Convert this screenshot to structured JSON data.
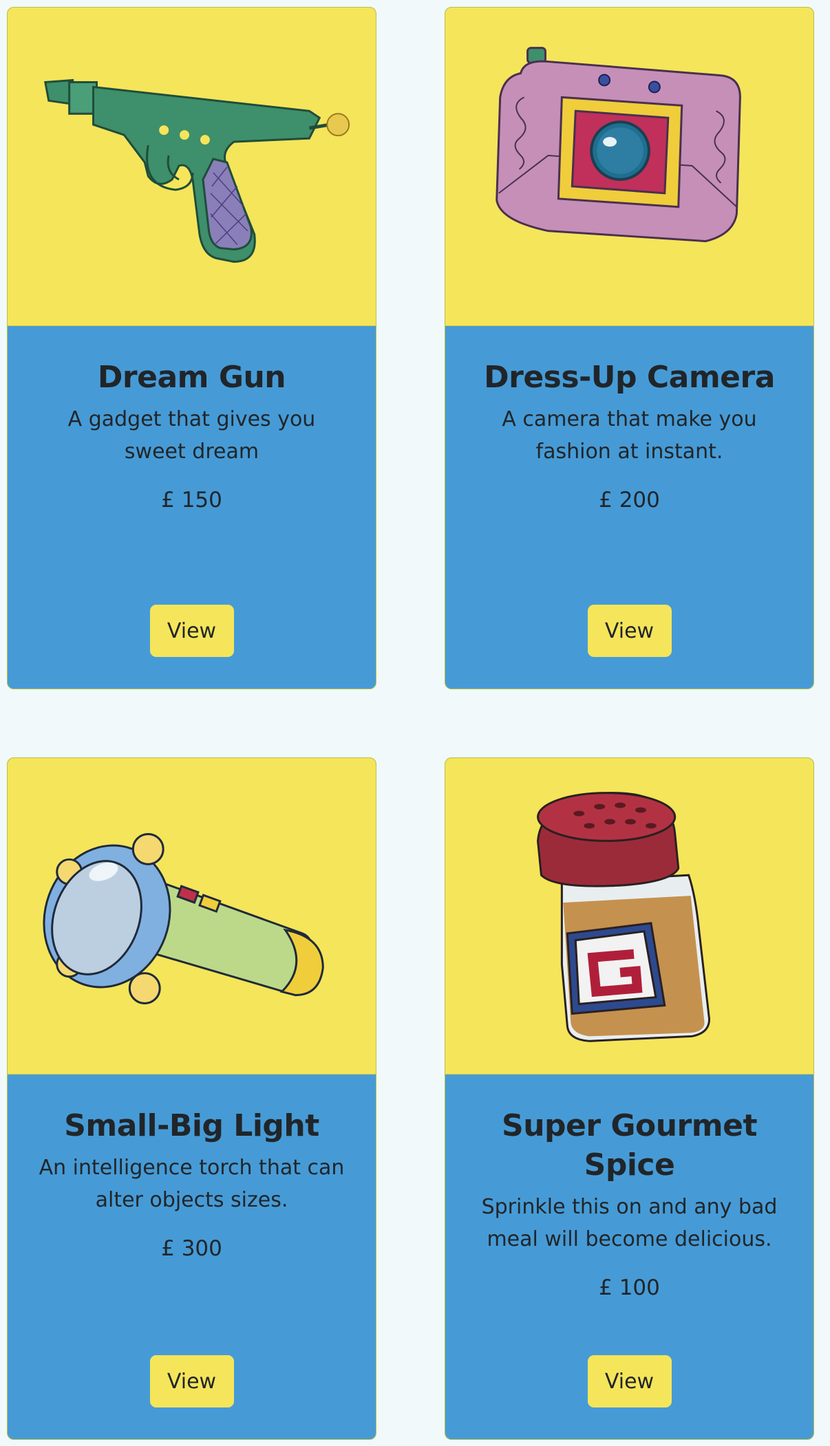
{
  "cards": [
    {
      "image_icon": "dream-gun-illustration",
      "title": "Dream Gun",
      "description": "A gadget that gives you sweet dream",
      "price": "£ 150",
      "button_label": "View"
    },
    {
      "image_icon": "dress-up-camera-illustration",
      "title": "Dress-Up Camera",
      "description": "A camera that make you fashion at instant.",
      "price": "£ 200",
      "button_label": "View"
    },
    {
      "image_icon": "small-big-light-illustration",
      "title": "Small-Big Light",
      "description": "An intelligence torch that can alter objects sizes.",
      "price": "£ 300",
      "button_label": "View"
    },
    {
      "image_icon": "super-gourmet-spice-illustration",
      "title": "Super Gourmet Spice",
      "description": "Sprinkle this on and any bad meal will become delicious.",
      "price": "£ 100",
      "button_label": "View"
    }
  ],
  "colors": {
    "page_background": "#f1f9fb",
    "card_image_background": "#f5e55a",
    "card_body_background": "#469bd6",
    "button_background": "#f5e55a",
    "text": "#212529"
  }
}
